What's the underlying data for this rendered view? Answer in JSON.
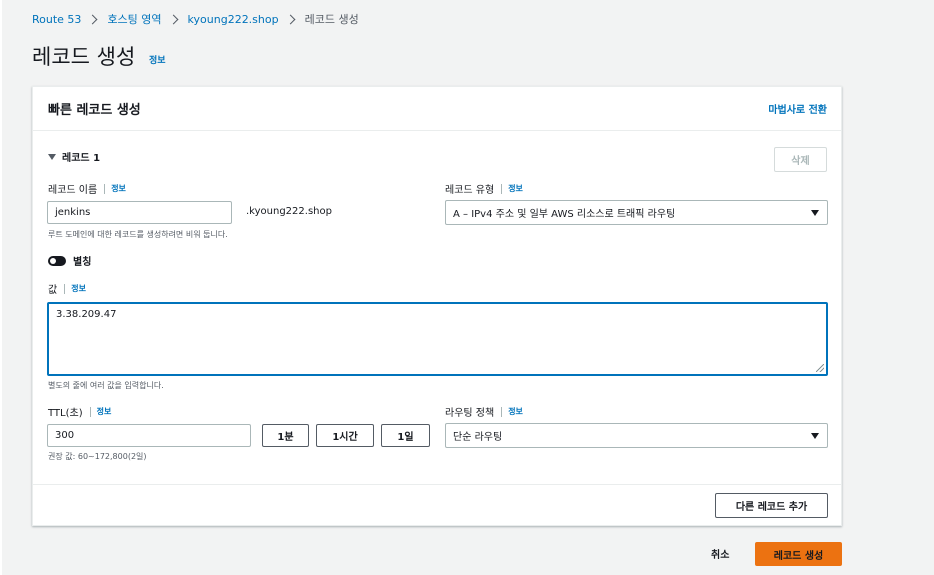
{
  "breadcrumb": {
    "items": [
      "Route 53",
      "호스팅 영역",
      "kyoung222.shop"
    ],
    "current": "레코드 생성"
  },
  "page": {
    "title": "레코드 생성",
    "info": "정보"
  },
  "panel": {
    "title": "빠른 레코드 생성",
    "wizard_link": "마법사로 전환"
  },
  "record": {
    "toggle_label": "레코드 1",
    "delete_label": "삭제",
    "name": {
      "label": "레코드 이름",
      "info": "정보",
      "value": "jenkins",
      "suffix": ".kyoung222.shop",
      "hint": "루트 도메인에 대한 레코드를 생성하려면 비워 둡니다."
    },
    "type": {
      "label": "레코드 유형",
      "info": "정보",
      "selected": "A – IPv4 주소 및 일부 AWS 리소스로 트래픽 라우팅"
    },
    "alias": {
      "label": "별칭",
      "enabled": false
    },
    "value": {
      "label": "값",
      "info": "정보",
      "text": "3.38.209.47",
      "hint": "별도의 줄에 여러 값을 입력합니다."
    },
    "ttl": {
      "label": "TTL(초)",
      "info": "정보",
      "value": "300",
      "buttons": [
        "1분",
        "1시간",
        "1일"
      ],
      "hint": "권장 값: 60~172,800(2일)"
    },
    "routing": {
      "label": "라우팅 정책",
      "info": "정보",
      "selected": "단순 라우팅"
    }
  },
  "actions": {
    "add_record": "다른 레코드 추가",
    "cancel": "취소",
    "create": "레코드 생성"
  },
  "colors": {
    "accent": "#0073bb",
    "primary_button": "#ec7211"
  }
}
